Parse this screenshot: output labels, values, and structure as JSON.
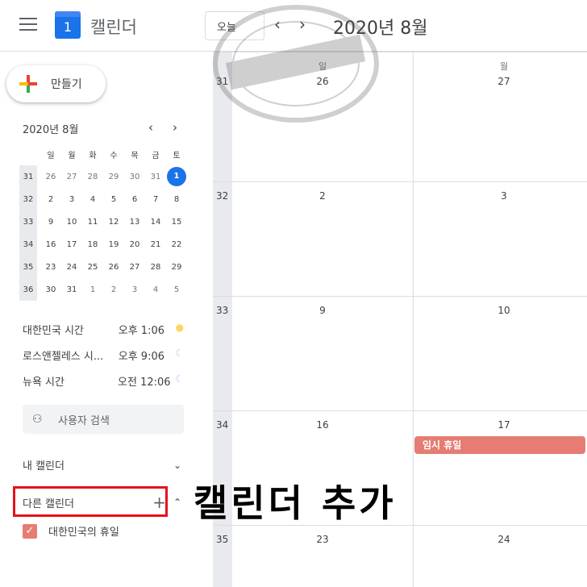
{
  "header": {
    "app_title": "캘린더",
    "logo_day": "1",
    "today_label": "오늘",
    "period": "2020년 8월",
    "prev_icon": "chevron-left-icon",
    "next_icon": "chevron-right-icon"
  },
  "sidebar": {
    "create_label": "만들기",
    "mini_calendar": {
      "month_label": "2020년 8월",
      "weekdays": [
        "일",
        "월",
        "화",
        "수",
        "목",
        "금",
        "토"
      ],
      "weeks": [
        {
          "wk": "31",
          "days": [
            "26",
            "27",
            "28",
            "29",
            "30",
            "31",
            "1"
          ]
        },
        {
          "wk": "32",
          "days": [
            "2",
            "3",
            "4",
            "5",
            "6",
            "7",
            "8"
          ]
        },
        {
          "wk": "33",
          "days": [
            "9",
            "10",
            "11",
            "12",
            "13",
            "14",
            "15"
          ]
        },
        {
          "wk": "34",
          "days": [
            "16",
            "17",
            "18",
            "19",
            "20",
            "21",
            "22"
          ]
        },
        {
          "wk": "35",
          "days": [
            "23",
            "24",
            "25",
            "26",
            "27",
            "28",
            "29"
          ]
        },
        {
          "wk": "36",
          "days": [
            "30",
            "31",
            "1",
            "2",
            "3",
            "4",
            "5"
          ]
        }
      ],
      "selected_day": "1"
    },
    "timezones": [
      {
        "name": "대한민국 시간",
        "time": "오후 1:06",
        "icon": "sun-icon"
      },
      {
        "name": "로스앤젤레스 시...",
        "time": "오후 9:06",
        "icon": "moon-icon"
      },
      {
        "name": "뉴욕 시간",
        "time": "오전 12:06",
        "icon": "moon-icon"
      }
    ],
    "people_search_placeholder": "사용자 검색",
    "my_calendars_label": "내 캘린더",
    "other_calendars_label": "다른 캘린더",
    "other_calendar_items": [
      {
        "label": "대한민국의 휴일",
        "checked": true,
        "color": "#e67c73"
      }
    ]
  },
  "main": {
    "columns": [
      {
        "dow": "일"
      },
      {
        "dow": "월"
      }
    ],
    "weeks": [
      {
        "wk": "31",
        "days": [
          "26",
          "27"
        ]
      },
      {
        "wk": "32",
        "days": [
          "2",
          "3"
        ]
      },
      {
        "wk": "33",
        "days": [
          "9",
          "10"
        ]
      },
      {
        "wk": "34",
        "days": [
          "16",
          "17"
        ]
      },
      {
        "wk": "35",
        "days": [
          "23",
          "24"
        ]
      }
    ],
    "events": [
      {
        "title": "임시 휴일",
        "day": "17",
        "color": "#e67c73"
      }
    ]
  },
  "annotation": {
    "overlay_text": "캘린더 추가"
  },
  "colors": {
    "accent": "#1a73e8",
    "holiday": "#e67c73",
    "highlight_box": "#e8101a"
  }
}
